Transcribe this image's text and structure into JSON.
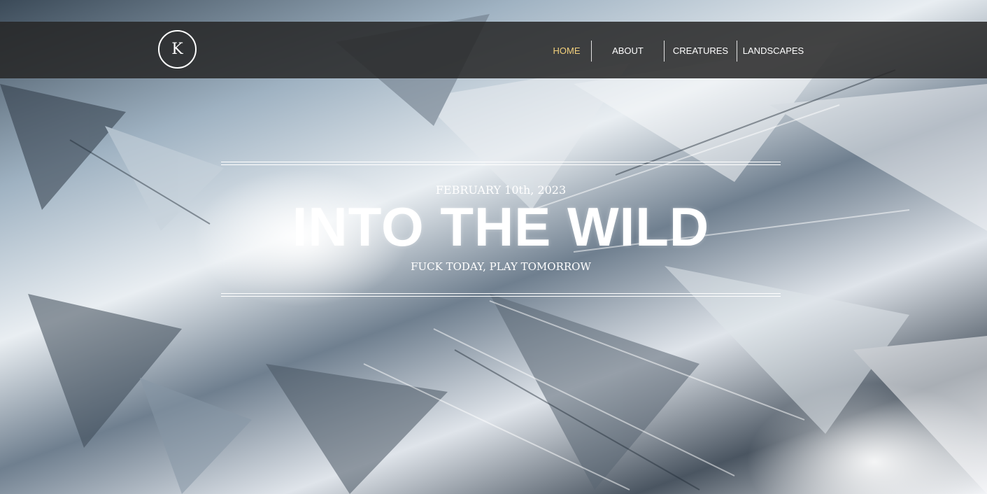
{
  "logo": {
    "letter": "K"
  },
  "nav": {
    "items": [
      {
        "label": "HOME",
        "active": true
      },
      {
        "label": "ABOUT",
        "active": false
      },
      {
        "label": "CREATURES",
        "active": false
      },
      {
        "label": "LANDSCAPES",
        "active": false
      }
    ]
  },
  "hero": {
    "date": "FEBRUARY 10th, 2023",
    "title": "INTO THE WILD",
    "subtitle": "FUCK TODAY, PLAY TOMORROW"
  },
  "colors": {
    "nav_background": "#262626",
    "nav_active": "#f1cf7b",
    "text": "#ffffff"
  }
}
